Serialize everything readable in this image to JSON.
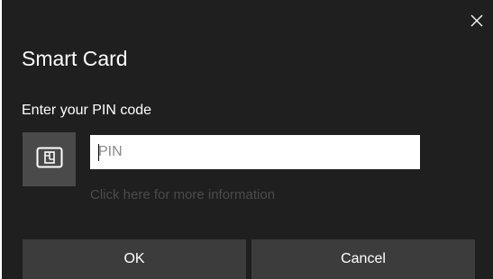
{
  "dialog": {
    "title": "Smart Card",
    "prompt": "Enter your PIN code",
    "close_icon": "close-icon",
    "card_icon": "smart-card-icon",
    "pin_field": {
      "placeholder": "PIN",
      "value": ""
    },
    "info_link": "Click here for more information",
    "buttons": {
      "ok_label": "OK",
      "cancel_label": "Cancel"
    },
    "colors": {
      "background": "#1f1f1f",
      "tile": "#4a4a4a",
      "button": "#3c3c3c",
      "link": "#4b4b4b"
    }
  }
}
